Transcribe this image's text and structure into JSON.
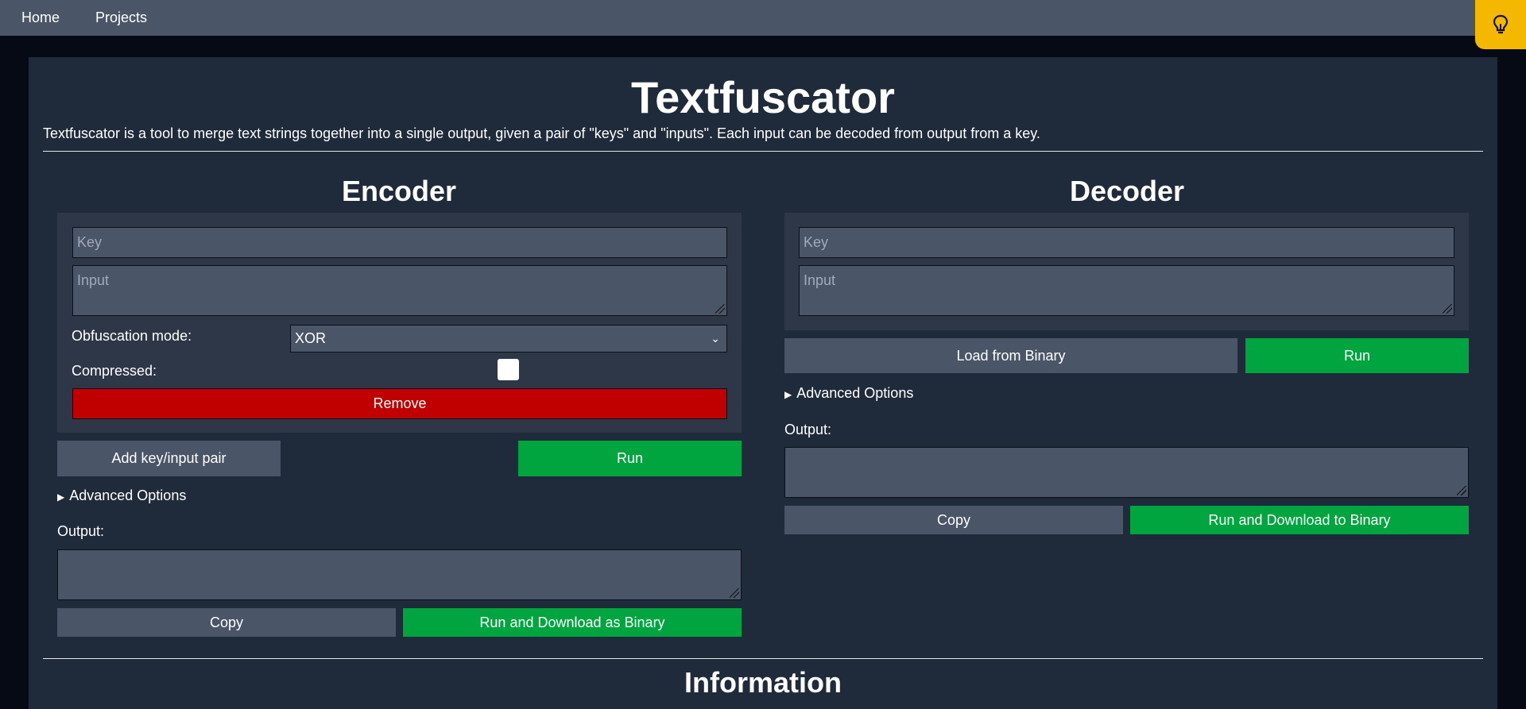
{
  "nav": {
    "home": "Home",
    "projects": "Projects"
  },
  "page": {
    "title": "Textfuscator",
    "description": "Textfuscator is a tool to merge text strings together into a single output, given a pair of \"keys\" and \"inputs\". Each input can be decoded from output from a key.",
    "info_heading": "Information"
  },
  "encoder": {
    "heading": "Encoder",
    "key_placeholder": "Key",
    "input_placeholder": "Input",
    "mode_label": "Obfuscation mode:",
    "mode_value": "XOR",
    "compressed_label": "Compressed:",
    "remove_label": "Remove",
    "add_pair_label": "Add key/input pair",
    "run_label": "Run",
    "advanced_label": "Advanced Options",
    "output_label": "Output:",
    "copy_label": "Copy",
    "download_label": "Run and Download as Binary"
  },
  "decoder": {
    "heading": "Decoder",
    "key_placeholder": "Key",
    "input_placeholder": "Input",
    "load_label": "Load from Binary",
    "run_label": "Run",
    "advanced_label": "Advanced Options",
    "output_label": "Output:",
    "copy_label": "Copy",
    "download_label": "Run and Download to Binary"
  },
  "colors": {
    "accent_green": "#00a53f",
    "danger_red": "#c00000",
    "hint_yellow": "#f5b800"
  },
  "icons": {
    "hint": "lightbulb-icon",
    "advanced": "triangle-right-icon",
    "select": "chevron-down-icon"
  }
}
